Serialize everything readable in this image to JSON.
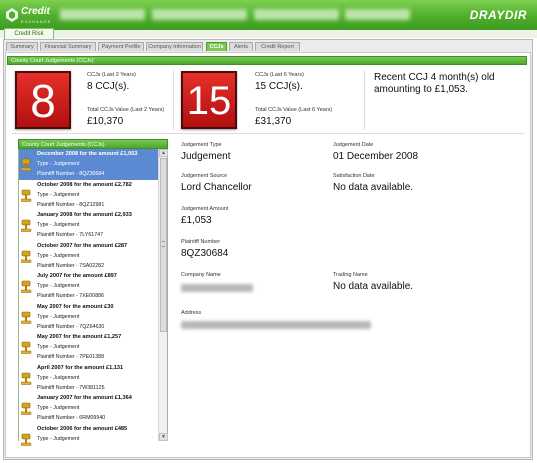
{
  "app": {
    "brand": "Credit",
    "brand_sub": "EXCHANGE",
    "logo": "DRAYDIR"
  },
  "main_tab": "Credit Risk",
  "subtabs": [
    {
      "label": "Summary",
      "active": false
    },
    {
      "label": "Financial Summary",
      "active": false
    },
    {
      "label": "Payment Profile",
      "active": false
    },
    {
      "label": "Company Information",
      "active": false
    },
    {
      "label": "CCJs",
      "active": true
    },
    {
      "label": "Alerts",
      "active": false
    },
    {
      "label": "Credit Report",
      "active": false
    }
  ],
  "panel_title": "County Court Judgements (CCJs)",
  "summary": {
    "last2": {
      "count": "8",
      "count_label": "CCJs (Last 2 Years)",
      "count_text": "8 CCJ(s).",
      "value_label": "Total CCJs Value (Last 2 Years)",
      "value": "£10,370"
    },
    "last6": {
      "count": "15",
      "count_label": "CCJs (Last 6 Years)",
      "count_text": "15 CCJ(s).",
      "value_label": "Total CCJs Value (Last 6 Years)",
      "value": "£31,370"
    },
    "recent": "Recent CCJ 4 month(s) old amounting to £1,053."
  },
  "list_title": "County Court Judgements (CCJs)",
  "ccj_list": [
    {
      "title": "December 2008 for the amount £1,053",
      "type": "Type - Judgement",
      "plaintiff": "Plaintiff Number - 8QZ30684",
      "selected": true
    },
    {
      "title": "October 2008 for the amount £2,782",
      "type": "Type - Judgement",
      "plaintiff": "Plaintiff Number - 8QZ12981",
      "selected": false
    },
    {
      "title": "January 2008 for the amount £2,933",
      "type": "Type - Judgement",
      "plaintiff": "Plaintiff Number - 7LY61747",
      "selected": false
    },
    {
      "title": "October 2007 for the amount £287",
      "type": "Type - Judgement",
      "plaintiff": "Plaintiff Number - 7SA02282",
      "selected": false
    },
    {
      "title": "July 2007 for the amount £897",
      "type": "Type - Judgement",
      "plaintiff": "Plaintiff Number - 7XE00886",
      "selected": false
    },
    {
      "title": "May 2007 for the amount £30",
      "type": "Type - Judgement",
      "plaintiff": "Plaintiff Number - 7QZ64630",
      "selected": false
    },
    {
      "title": "May 2007 for the amount £1,257",
      "type": "Type - Judgement",
      "plaintiff": "Plaintiff Number - 7PE01388",
      "selected": false
    },
    {
      "title": "April 2007 for the amount £1,131",
      "type": "Type - Judgement",
      "plaintiff": "Plaintiff Number - 7W381125",
      "selected": false
    },
    {
      "title": "January 2007 for the amount £1,364",
      "type": "Type - Judgement",
      "plaintiff": "Plaintiff Number - 6RM09940",
      "selected": false
    },
    {
      "title": "October 2006 for the amount £485",
      "type": "Type - Judgement",
      "plaintiff": "",
      "selected": false
    }
  ],
  "detail": {
    "judgement_type_label": "Judgement Type",
    "judgement_type": "Judgement",
    "judgement_date_label": "Judgement Date",
    "judgement_date": "01 December 2008",
    "judgement_source_label": "Judgement Source",
    "judgement_source": "Lord Chancellor",
    "satisfaction_date_label": "Satisfaction Date",
    "satisfaction_date": "No data available.",
    "judgement_amount_label": "Judgement Amount",
    "judgement_amount": "£1,053",
    "plaintiff_number_label": "Plaintiff Number",
    "plaintiff_number": "8QZ30684",
    "company_name_label": "Company Name",
    "trading_name_label": "Trading Name",
    "trading_name": "No data available.",
    "address_label": "Address"
  },
  "colors": {
    "brand_green": "#4fae2c",
    "alert_red": "#d42020",
    "selection_blue": "#5b8ad3"
  },
  "icons": {
    "list_item": "gavel-icon",
    "brand": "credit-mark-icon"
  }
}
